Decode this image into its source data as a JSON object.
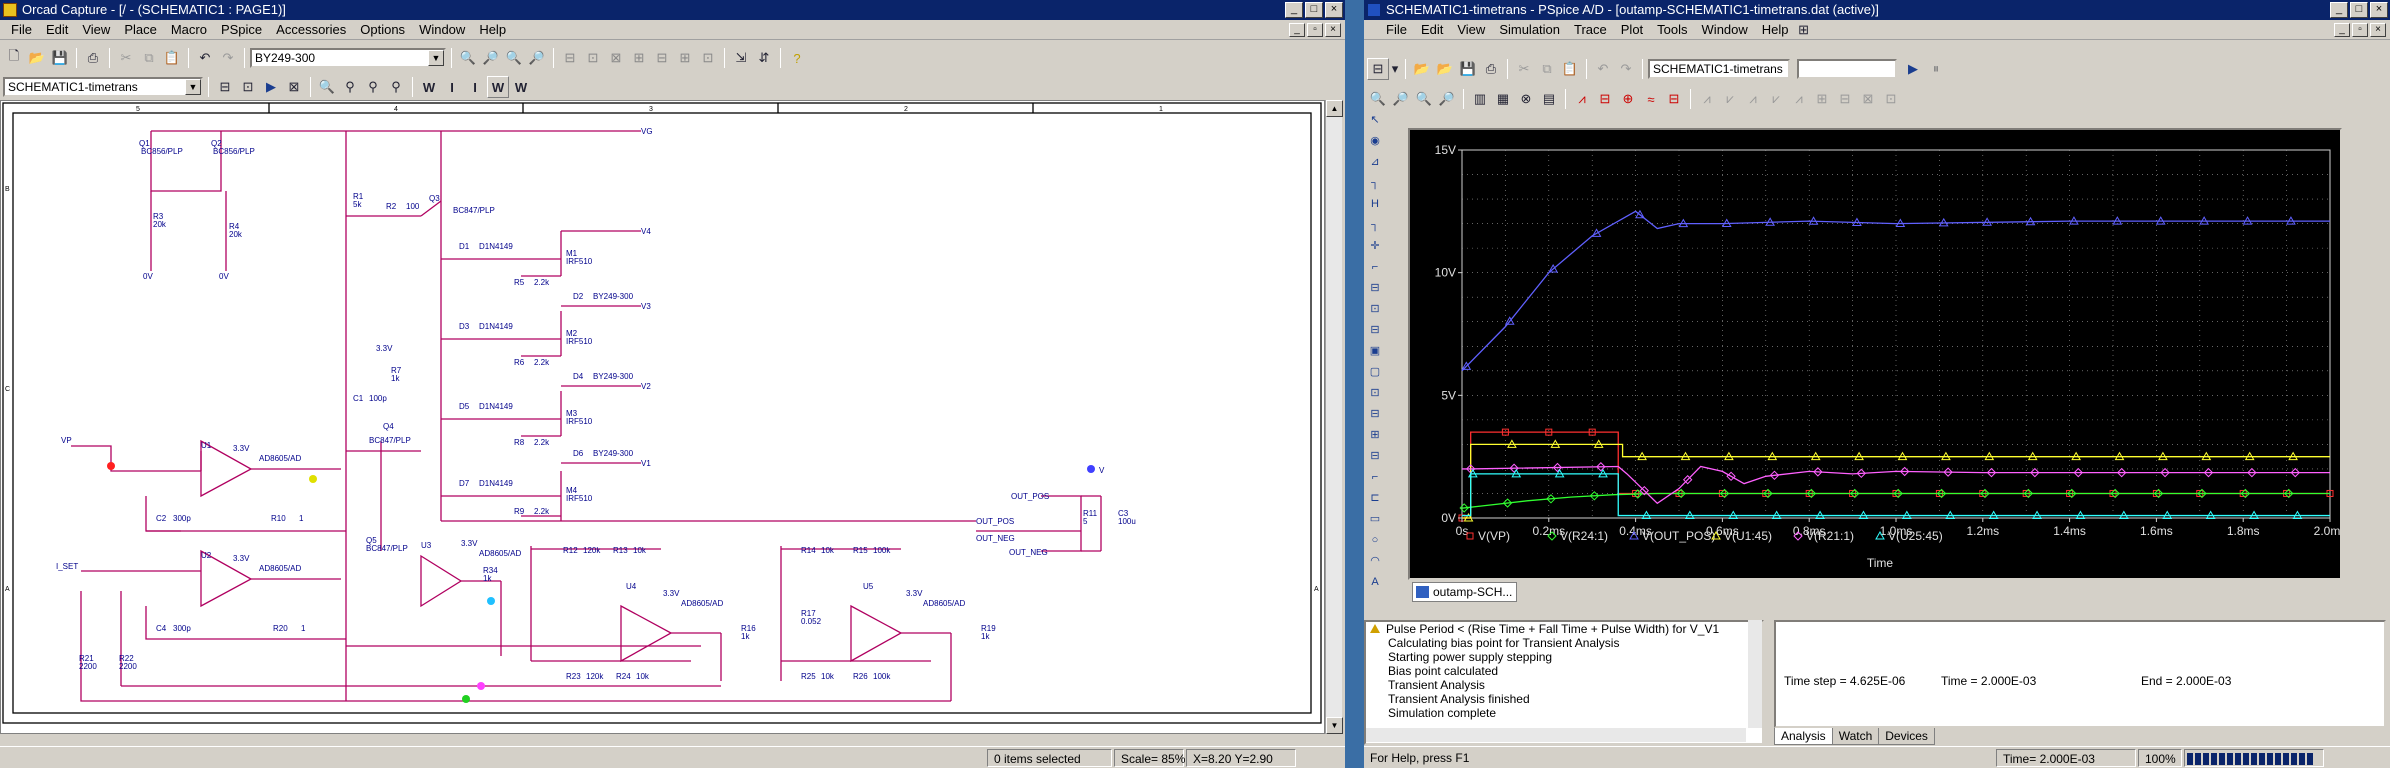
{
  "capture": {
    "title": "Orcad Capture - [/ - (SCHEMATIC1 : PAGE1)]",
    "menu": [
      "File",
      "Edit",
      "View",
      "Place",
      "Macro",
      "PSpice",
      "Accessories",
      "Options",
      "Window",
      "Help"
    ],
    "part_combo": "BY249-300",
    "schematic_combo": "SCHEMATIC1-timetrans",
    "tool_letters": [
      "W",
      "I",
      "I",
      "W",
      "W"
    ],
    "status": {
      "selection": "0 items selected",
      "scale": "Scale= 85%",
      "xy": "X=8.20  Y=2.90"
    },
    "border_cols": [
      "5",
      "4",
      "3",
      "2",
      "1"
    ],
    "border_rows": [
      "B",
      "C",
      "A",
      "A"
    ]
  },
  "schematic": {
    "q1": {
      "ref": "Q1",
      "model": "BC856/PLP"
    },
    "q2": {
      "ref": "Q2",
      "model": "BC856/PLP"
    },
    "q3": {
      "ref": "Q3",
      "model": "BC847/PLP"
    },
    "q4": {
      "ref": "Q4",
      "model": "BC847/PLP"
    },
    "q5": {
      "ref": "Q5",
      "model": "BC847/PLP"
    },
    "r1": {
      "ref": "R1",
      "val": "5k"
    },
    "r2": {
      "ref": "R2",
      "val": "100"
    },
    "r3": {
      "ref": "R3",
      "val": "20k"
    },
    "r4": {
      "ref": "R4",
      "val": "20k"
    },
    "r5": {
      "ref": "R5",
      "val": "2.2k"
    },
    "r6": {
      "ref": "R6",
      "val": "2.2k"
    },
    "r7": {
      "ref": "R7",
      "val": "1k"
    },
    "r8": {
      "ref": "R8",
      "val": "2.2k"
    },
    "r9": {
      "ref": "R9",
      "val": "2.2k"
    },
    "r10": {
      "ref": "R10",
      "val": "1"
    },
    "r11": {
      "ref": "R11",
      "val": "5"
    },
    "r12": {
      "ref": "R12",
      "val": "120k"
    },
    "r13": {
      "ref": "R13",
      "val": "10k"
    },
    "r14": {
      "ref": "R14",
      "val": "10k"
    },
    "r15": {
      "ref": "R15",
      "val": "100k"
    },
    "r16": {
      "ref": "R16",
      "val": "1k"
    },
    "r17": {
      "ref": "R17",
      "val": "0.052"
    },
    "r18": {
      "ref": "R18",
      "val": "1k"
    },
    "r19": {
      "ref": "R19",
      "val": "1k"
    },
    "r20": {
      "ref": "R20",
      "val": "1"
    },
    "r21": {
      "ref": "R21",
      "val": "2200"
    },
    "r22": {
      "ref": "R22",
      "val": "2200"
    },
    "r23": {
      "ref": "R23",
      "val": "120k"
    },
    "r24": {
      "ref": "R24",
      "val": "10k"
    },
    "r25": {
      "ref": "R25",
      "val": "10k"
    },
    "r26": {
      "ref": "R26",
      "val": "100k"
    },
    "r34": {
      "ref": "R34",
      "val": "1k"
    },
    "c1": {
      "ref": "C1",
      "val": "100p"
    },
    "c2": {
      "ref": "C2",
      "val": "300p"
    },
    "c3": {
      "ref": "C3",
      "val": "100u"
    },
    "c4": {
      "ref": "C4",
      "val": "300p"
    },
    "d1": {
      "ref": "D1",
      "model": "D1N4149"
    },
    "d3": {
      "ref": "D3",
      "model": "D1N4149"
    },
    "d5": {
      "ref": "D5",
      "model": "D1N4149"
    },
    "d7": {
      "ref": "D7",
      "model": "D1N4149"
    },
    "d2": {
      "ref": "D2",
      "model": "BY249-300"
    },
    "d4": {
      "ref": "D4",
      "model": "BY249-300"
    },
    "d6": {
      "ref": "D6",
      "model": "BY249-300"
    },
    "m1": {
      "ref": "M1",
      "model": "IRF510"
    },
    "m2": {
      "ref": "M2",
      "model": "IRF510"
    },
    "m3": {
      "ref": "M3",
      "model": "IRF510"
    },
    "m4": {
      "ref": "M4",
      "model": "IRF510"
    },
    "u1": {
      "ref": "U1",
      "model": "AD8605/AD"
    },
    "u2": {
      "ref": "U2",
      "model": "AD8605/AD"
    },
    "u3": {
      "ref": "U3",
      "model": "AD8605/AD"
    },
    "u4": {
      "ref": "U4",
      "model": "AD8605/AD"
    },
    "u5": {
      "ref": "U5",
      "model": "AD8605/AD"
    },
    "supply": "3.3V",
    "gnd": "0V",
    "nets": {
      "vg": "VG",
      "v4": "V4",
      "v3": "V3",
      "v2": "V2",
      "v1": "V1",
      "vp": "VP",
      "iset": "I_SET",
      "out_pos": "OUT_POS",
      "out_neg": "OUT_NEG",
      "v": "V"
    }
  },
  "pspice": {
    "title": "SCHEMATIC1-timetrans - PSpice A/D - [outamp-SCHEMATIC1-timetrans.dat (active)]",
    "menu": [
      "File",
      "Edit",
      "View",
      "Simulation",
      "Trace",
      "Plot",
      "Tools",
      "Window",
      "Help"
    ],
    "profile_combo": "SCHEMATIC1-timetrans",
    "doc_tab": "outamp-SCH...",
    "output_lines": [
      "Pulse Period < (Rise Time + Fall Time + Pulse Width) for V_V1",
      "Calculating bias point for Transient Analysis",
      "Starting power supply stepping",
      "Bias point calculated",
      "Transient Analysis",
      "Transient Analysis finished",
      "Simulation complete"
    ],
    "sim_status": {
      "time_step": "Time step = 4.625E-06",
      "time": "Time = 2.000E-03",
      "end": "End = 2.000E-03"
    },
    "sim_tabs": [
      "Analysis",
      "Watch",
      "Devices"
    ],
    "status": {
      "help": "For Help, press F1",
      "time": "Time= 2.000E-03",
      "zoom": "100%"
    },
    "colors": {
      "bg": "#000000",
      "grid": "#a0a0a0",
      "axis": "#d0d0d0"
    }
  },
  "chart_data": {
    "type": "line",
    "xlabel": "Time",
    "x_ticks": [
      "0s",
      "0.2ms",
      "0.4ms",
      "0.6ms",
      "0.8ms",
      "1.0ms",
      "1.2ms",
      "1.4ms",
      "1.6ms",
      "1.8ms",
      "2.0ms"
    ],
    "y_ticks": [
      "0V",
      "5V",
      "10V",
      "15V"
    ],
    "xlim": [
      0,
      2.0
    ],
    "ylim": [
      0,
      15
    ],
    "x_unit": "ms",
    "grid": true,
    "legend_position": "bottom",
    "series": [
      {
        "name": "V(VP)",
        "color": "#ff3030",
        "marker": "square",
        "x": [
          0,
          0.02,
          0.02,
          0.36,
          0.36,
          2.0
        ],
        "y": [
          0,
          0,
          3.5,
          3.5,
          1.0,
          1.0
        ]
      },
      {
        "name": "V(R24:1)",
        "color": "#30ff30",
        "marker": "diamond",
        "x": [
          0,
          0.05,
          0.15,
          0.25,
          0.35,
          0.45,
          0.6,
          2.0
        ],
        "y": [
          0.4,
          0.5,
          0.7,
          0.85,
          0.95,
          1.0,
          1.0,
          1.0
        ]
      },
      {
        "name": "V(OUT_POS)",
        "color": "#6060ff",
        "marker": "triangle",
        "x": [
          0,
          0.1,
          0.2,
          0.3,
          0.4,
          0.45,
          0.5,
          0.6,
          0.8,
          1.0,
          1.4,
          2.0
        ],
        "y": [
          6.0,
          7.8,
          10.0,
          11.5,
          12.5,
          11.8,
          12.0,
          12.0,
          12.1,
          12.0,
          12.1,
          12.1
        ]
      },
      {
        "name": "V(U1:45)",
        "color": "#ffff30",
        "marker": "triangle",
        "x": [
          0,
          0.02,
          0.02,
          0.37,
          0.37,
          2.0
        ],
        "y": [
          0,
          0,
          3.0,
          3.0,
          2.5,
          2.5
        ]
      },
      {
        "name": "V(R21:1)",
        "color": "#ff60ff",
        "marker": "diamond",
        "x": [
          0,
          0.02,
          0.36,
          0.38,
          0.45,
          0.5,
          0.55,
          0.6,
          0.65,
          0.7,
          0.8,
          0.9,
          1.0,
          1.2,
          2.0
        ],
        "y": [
          2.0,
          2.0,
          2.1,
          1.8,
          0.6,
          1.2,
          2.1,
          1.9,
          1.4,
          1.7,
          1.9,
          1.8,
          1.9,
          1.85,
          1.85
        ]
      },
      {
        "name": "V(U25:45)",
        "color": "#30ffff",
        "marker": "triangle",
        "x": [
          0,
          0.02,
          0.02,
          0.36,
          0.36,
          2.0
        ],
        "y": [
          0.1,
          0.1,
          1.8,
          1.8,
          0.1,
          0.1
        ]
      }
    ]
  }
}
